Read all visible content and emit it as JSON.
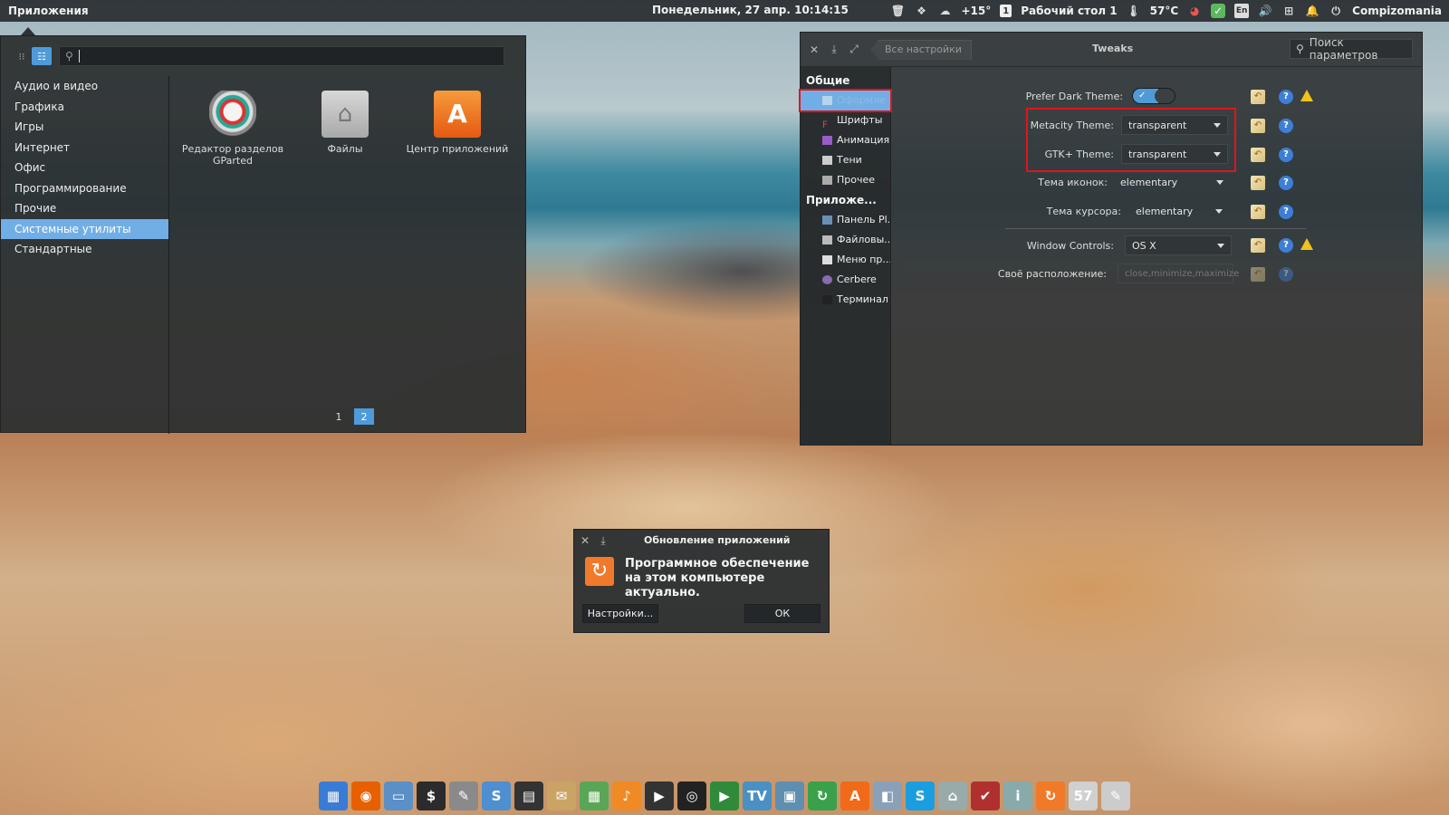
{
  "top_panel": {
    "apps_label": "Приложения",
    "clock": "Понедельник, 27 апр. 10:14:15",
    "weather": "+15°",
    "workspace_num": "1",
    "workspace": "Рабочий стол 1",
    "temperature": "57°C",
    "keyboard_layout": "En",
    "user": "Compizomania"
  },
  "app_menu": {
    "search_placeholder": "",
    "categories": [
      "Аудио и видео",
      "Графика",
      "Игры",
      "Интернет",
      "Офис",
      "Программирование",
      "Прочие",
      "Системные утилиты",
      "Стандартные"
    ],
    "selected_category": "Системные утилиты",
    "apps": [
      {
        "label": "Редактор разделов GParted",
        "icon": "gparted-icon"
      },
      {
        "label": "Файлы",
        "icon": "files-icon"
      },
      {
        "label": "Центр приложений",
        "icon": "software-center-icon"
      }
    ],
    "pages": [
      "1",
      "2"
    ],
    "current_page": "2"
  },
  "tweaks": {
    "title": "Tweaks",
    "back_label": "Все настройки",
    "search_placeholder": "Поиск параметров",
    "sidebar": {
      "group_general": "Общие",
      "general_items": [
        "Оформле",
        "Шрифты",
        "Анимация",
        "Тени",
        "Прочее"
      ],
      "group_apps": "Приложе...",
      "app_items": [
        "Панель Pl...",
        "Файловы...",
        "Меню пр...",
        "Cerbere",
        "Терминал"
      ],
      "selected": "Оформле"
    },
    "settings": {
      "prefer_dark_label": "Prefer Dark Theme:",
      "prefer_dark_on": true,
      "metacity_label": "Metacity Theme:",
      "metacity_value": "transparent",
      "gtk_label": "GTK+ Theme:",
      "gtk_value": "transparent",
      "icons_label": "Тема иконок:",
      "icons_value": "elementary",
      "cursor_label": "Тема курсора:",
      "cursor_value": "elementary",
      "window_controls_label": "Window Controls:",
      "window_controls_value": "OS X",
      "custom_layout_label": "Своё расположение:",
      "custom_layout_value": "close,minimize,maximize"
    }
  },
  "update_dialog": {
    "title": "Обновление приложений",
    "message": "Программное обеспечение на этом компьютере актуально.",
    "settings_button": "Настройки...",
    "ok_button": "ОК"
  },
  "dock": {
    "icons": [
      {
        "name": "workspaces-icon",
        "color": "#3a7bd5",
        "glyph": "▦"
      },
      {
        "name": "firefox-icon",
        "color": "#e66000",
        "glyph": "◉"
      },
      {
        "name": "files-icon",
        "color": "#5b8fc7",
        "glyph": "▭"
      },
      {
        "name": "terminal-icon",
        "color": "#2b2b2b",
        "glyph": "$"
      },
      {
        "name": "text-editor-icon",
        "color": "#8a8a8a",
        "glyph": "✎"
      },
      {
        "name": "midori-icon",
        "color": "#4d8fd1",
        "glyph": "S"
      },
      {
        "name": "system-monitor-icon",
        "color": "#333",
        "glyph": "▤"
      },
      {
        "name": "mail-icon",
        "color": "#c9a464",
        "glyph": "✉"
      },
      {
        "name": "calendar-icon",
        "color": "#5aa657",
        "glyph": "▦"
      },
      {
        "name": "music-icon",
        "color": "#f08a24",
        "glyph": "♪"
      },
      {
        "name": "video-icon",
        "color": "#333",
        "glyph": "▶"
      },
      {
        "name": "screenshot-icon",
        "color": "#222",
        "glyph": "◎"
      },
      {
        "name": "play-icon",
        "color": "#2f8a3a",
        "glyph": "▶"
      },
      {
        "name": "tv-icon",
        "color": "#4a90c2",
        "glyph": "TV"
      },
      {
        "name": "photos-icon",
        "color": "#5f8fb0",
        "glyph": "▣"
      },
      {
        "name": "sync-icon",
        "color": "#3aa04a",
        "glyph": "↻"
      },
      {
        "name": "software-center-icon",
        "color": "#f06a1a",
        "glyph": "A"
      },
      {
        "name": "switch-icon",
        "color": "#8aa0b8",
        "glyph": "◧"
      },
      {
        "name": "skype-icon",
        "color": "#1a9ee0",
        "glyph": "S"
      },
      {
        "name": "home-folder-icon",
        "color": "#9aa",
        "glyph": "⌂"
      },
      {
        "name": "search-tool-icon",
        "color": "#b03030",
        "glyph": "✔"
      },
      {
        "name": "info-icon",
        "color": "#8aa",
        "glyph": "i"
      },
      {
        "name": "update-icon",
        "color": "#f07a2a",
        "glyph": "↻"
      },
      {
        "name": "notes-icon",
        "color": "#d0d0d0",
        "glyph": "57"
      },
      {
        "name": "pen-icon",
        "color": "#ccc",
        "glyph": "✎"
      }
    ]
  }
}
